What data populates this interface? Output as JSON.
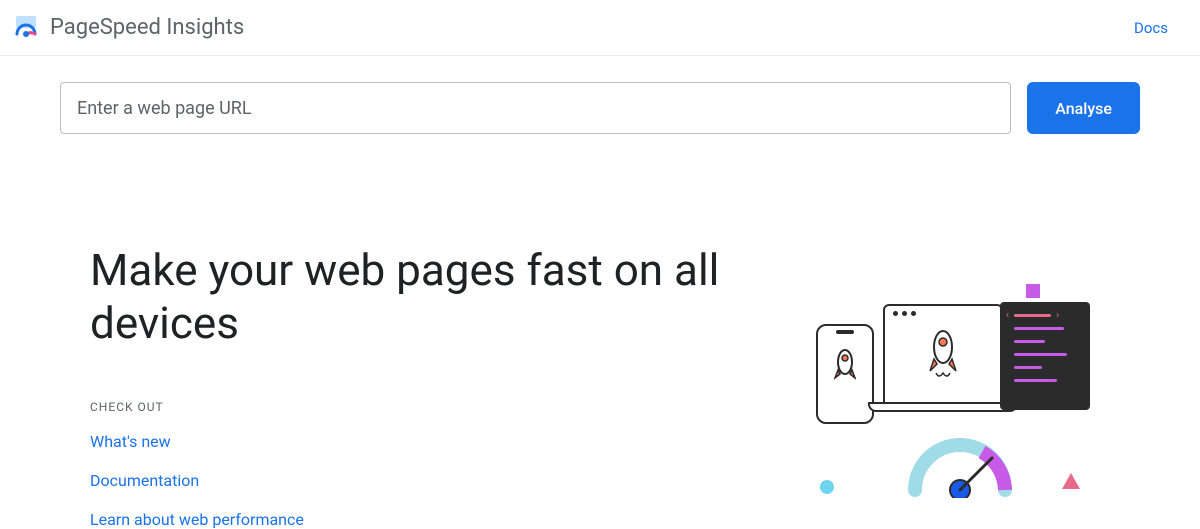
{
  "header": {
    "app_title": "PageSpeed Insights",
    "docs_label": "Docs"
  },
  "search": {
    "placeholder": "Enter a web page URL",
    "value": "",
    "button_label": "Analyse"
  },
  "hero": {
    "title": "Make your web pages fast on all devices",
    "checkout_label": "CHECK OUT",
    "links": [
      {
        "label": "What's new"
      },
      {
        "label": "Documentation"
      },
      {
        "label": "Learn about web performance"
      }
    ]
  },
  "colors": {
    "primary": "#1a73e8",
    "accent_purple": "#c85ae8",
    "accent_pink": "#e86a8a",
    "accent_cyan": "#6dd5ed"
  }
}
